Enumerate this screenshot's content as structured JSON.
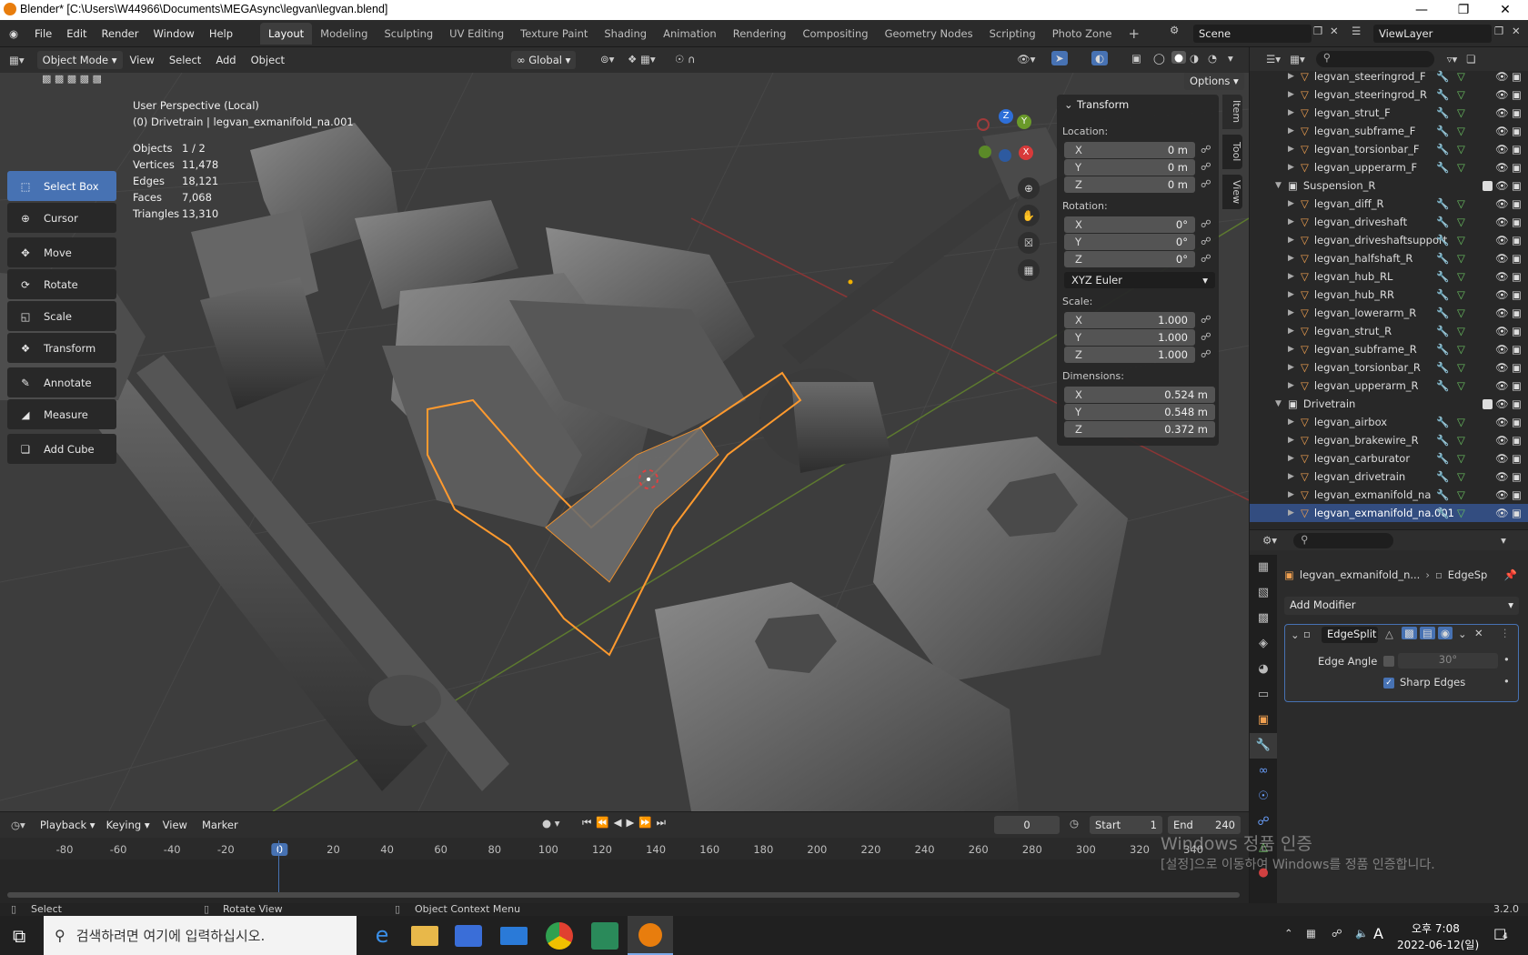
{
  "window": {
    "title": "Blender* [C:\\Users\\W44966\\Documents\\MEGAsync\\legvan\\legvan.blend]"
  },
  "topbar": {
    "menus": [
      "File",
      "Edit",
      "Render",
      "Window",
      "Help"
    ],
    "workspaces": [
      "Layout",
      "Modeling",
      "Sculpting",
      "UV Editing",
      "Texture Paint",
      "Shading",
      "Animation",
      "Rendering",
      "Compositing",
      "Geometry Nodes",
      "Scripting",
      "Photo Zone"
    ],
    "active_workspace": "Layout",
    "scene": "Scene",
    "view_layer": "ViewLayer"
  },
  "viewport_header": {
    "mode": "Object Mode",
    "menus": [
      "View",
      "Select",
      "Add",
      "Object"
    ],
    "orientation": "Global",
    "options": "Options"
  },
  "toolbar": {
    "tools": [
      {
        "label": "Select Box",
        "icon": "select-box-icon",
        "active": true
      },
      {
        "label": "Cursor",
        "icon": "cursor-icon"
      },
      {
        "label": "Move",
        "icon": "move-icon"
      },
      {
        "label": "Rotate",
        "icon": "rotate-icon"
      },
      {
        "label": "Scale",
        "icon": "scale-icon"
      },
      {
        "label": "Transform",
        "icon": "transform-icon"
      },
      {
        "label": "Annotate",
        "icon": "annotate-icon"
      },
      {
        "label": "Measure",
        "icon": "measure-icon"
      },
      {
        "label": "Add Cube",
        "icon": "add-cube-icon"
      }
    ]
  },
  "viewport_info": {
    "perspective": "User Perspective (Local)",
    "context": "(0) Drivetrain | legvan_exmanifold_na.001",
    "stats": [
      {
        "label": "Objects",
        "value": "1 / 2"
      },
      {
        "label": "Vertices",
        "value": "11,478"
      },
      {
        "label": "Edges",
        "value": "18,121"
      },
      {
        "label": "Faces",
        "value": "7,068"
      },
      {
        "label": "Triangles",
        "value": "13,310"
      }
    ]
  },
  "transform": {
    "title": "Transform",
    "location_label": "Location:",
    "location": [
      {
        "axis": "X",
        "value": "0 m"
      },
      {
        "axis": "Y",
        "value": "0 m"
      },
      {
        "axis": "Z",
        "value": "0 m"
      }
    ],
    "rotation_label": "Rotation:",
    "rotation": [
      {
        "axis": "X",
        "value": "0°"
      },
      {
        "axis": "Y",
        "value": "0°"
      },
      {
        "axis": "Z",
        "value": "0°"
      }
    ],
    "rotation_mode": "XYZ Euler",
    "scale_label": "Scale:",
    "scale": [
      {
        "axis": "X",
        "value": "1.000"
      },
      {
        "axis": "Y",
        "value": "1.000"
      },
      {
        "axis": "Z",
        "value": "1.000"
      }
    ],
    "dimensions_label": "Dimensions:",
    "dimensions": [
      {
        "axis": "X",
        "value": "0.524 m"
      },
      {
        "axis": "Y",
        "value": "0.548 m"
      },
      {
        "axis": "Z",
        "value": "0.372 m"
      }
    ]
  },
  "side_tabs": [
    "Item",
    "Tool",
    "View"
  ],
  "gizmo": {
    "z": "Z",
    "y": "Y",
    "x": "X"
  },
  "outliner": {
    "items": [
      {
        "name": "legvan_steeringrod_F",
        "type": "object"
      },
      {
        "name": "legvan_steeringrod_R",
        "type": "object"
      },
      {
        "name": "legvan_strut_F",
        "type": "object"
      },
      {
        "name": "legvan_subframe_F",
        "type": "object"
      },
      {
        "name": "legvan_torsionbar_F",
        "type": "object"
      },
      {
        "name": "legvan_upperarm_F",
        "type": "object"
      },
      {
        "name": "Suspension_R",
        "type": "collection"
      },
      {
        "name": "legvan_diff_R",
        "type": "object"
      },
      {
        "name": "legvan_driveshaft",
        "type": "object"
      },
      {
        "name": "legvan_driveshaftsupport",
        "type": "object"
      },
      {
        "name": "legvan_halfshaft_R",
        "type": "object"
      },
      {
        "name": "legvan_hub_RL",
        "type": "object"
      },
      {
        "name": "legvan_hub_RR",
        "type": "object"
      },
      {
        "name": "legvan_lowerarm_R",
        "type": "object"
      },
      {
        "name": "legvan_strut_R",
        "type": "object"
      },
      {
        "name": "legvan_subframe_R",
        "type": "object"
      },
      {
        "name": "legvan_torsionbar_R",
        "type": "object"
      },
      {
        "name": "legvan_upperarm_R",
        "type": "object"
      },
      {
        "name": "Drivetrain",
        "type": "collection"
      },
      {
        "name": "legvan_airbox",
        "type": "object"
      },
      {
        "name": "legvan_brakewire_R",
        "type": "object"
      },
      {
        "name": "legvan_carburator",
        "type": "object"
      },
      {
        "name": "legvan_drivetrain",
        "type": "object"
      },
      {
        "name": "legvan_exmanifold_na",
        "type": "object"
      },
      {
        "name": "legvan_exmanifold_na.001",
        "type": "object",
        "selected": true
      }
    ]
  },
  "properties": {
    "breadcrumb_object": "legvan_exmanifold_n...",
    "breadcrumb_modifier": "EdgeSp",
    "add_modifier": "Add Modifier",
    "modifier_name": "EdgeSplit",
    "edge_angle_label": "Edge Angle",
    "edge_angle_value": "30°",
    "sharp_edges_label": "Sharp Edges"
  },
  "timeline": {
    "menus": [
      "Playback",
      "Keying",
      "View",
      "Marker"
    ],
    "current_frame": "0",
    "start_label": "Start",
    "start": "1",
    "end_label": "End",
    "end": "240",
    "ticks": [
      "-80",
      "-60",
      "-40",
      "-20",
      "0",
      "20",
      "40",
      "60",
      "80",
      "100",
      "120",
      "140",
      "160",
      "180",
      "200",
      "220",
      "240",
      "260",
      "280",
      "300",
      "320",
      "340"
    ]
  },
  "watermark": {
    "line1": "Windows 정품 인증",
    "line2": "[설정]으로 이동하여 Windows를 정품 인증합니다."
  },
  "statusbar": {
    "select": "Select",
    "rotate": "Rotate View",
    "context": "Object Context Menu",
    "version": "3.2.0"
  },
  "taskbar": {
    "search_placeholder": "검색하려면 여기에 입력하십시오.",
    "time": "오후 7:08",
    "date": "2022-06-12(일)",
    "ime": "A",
    "notifications": "4"
  }
}
